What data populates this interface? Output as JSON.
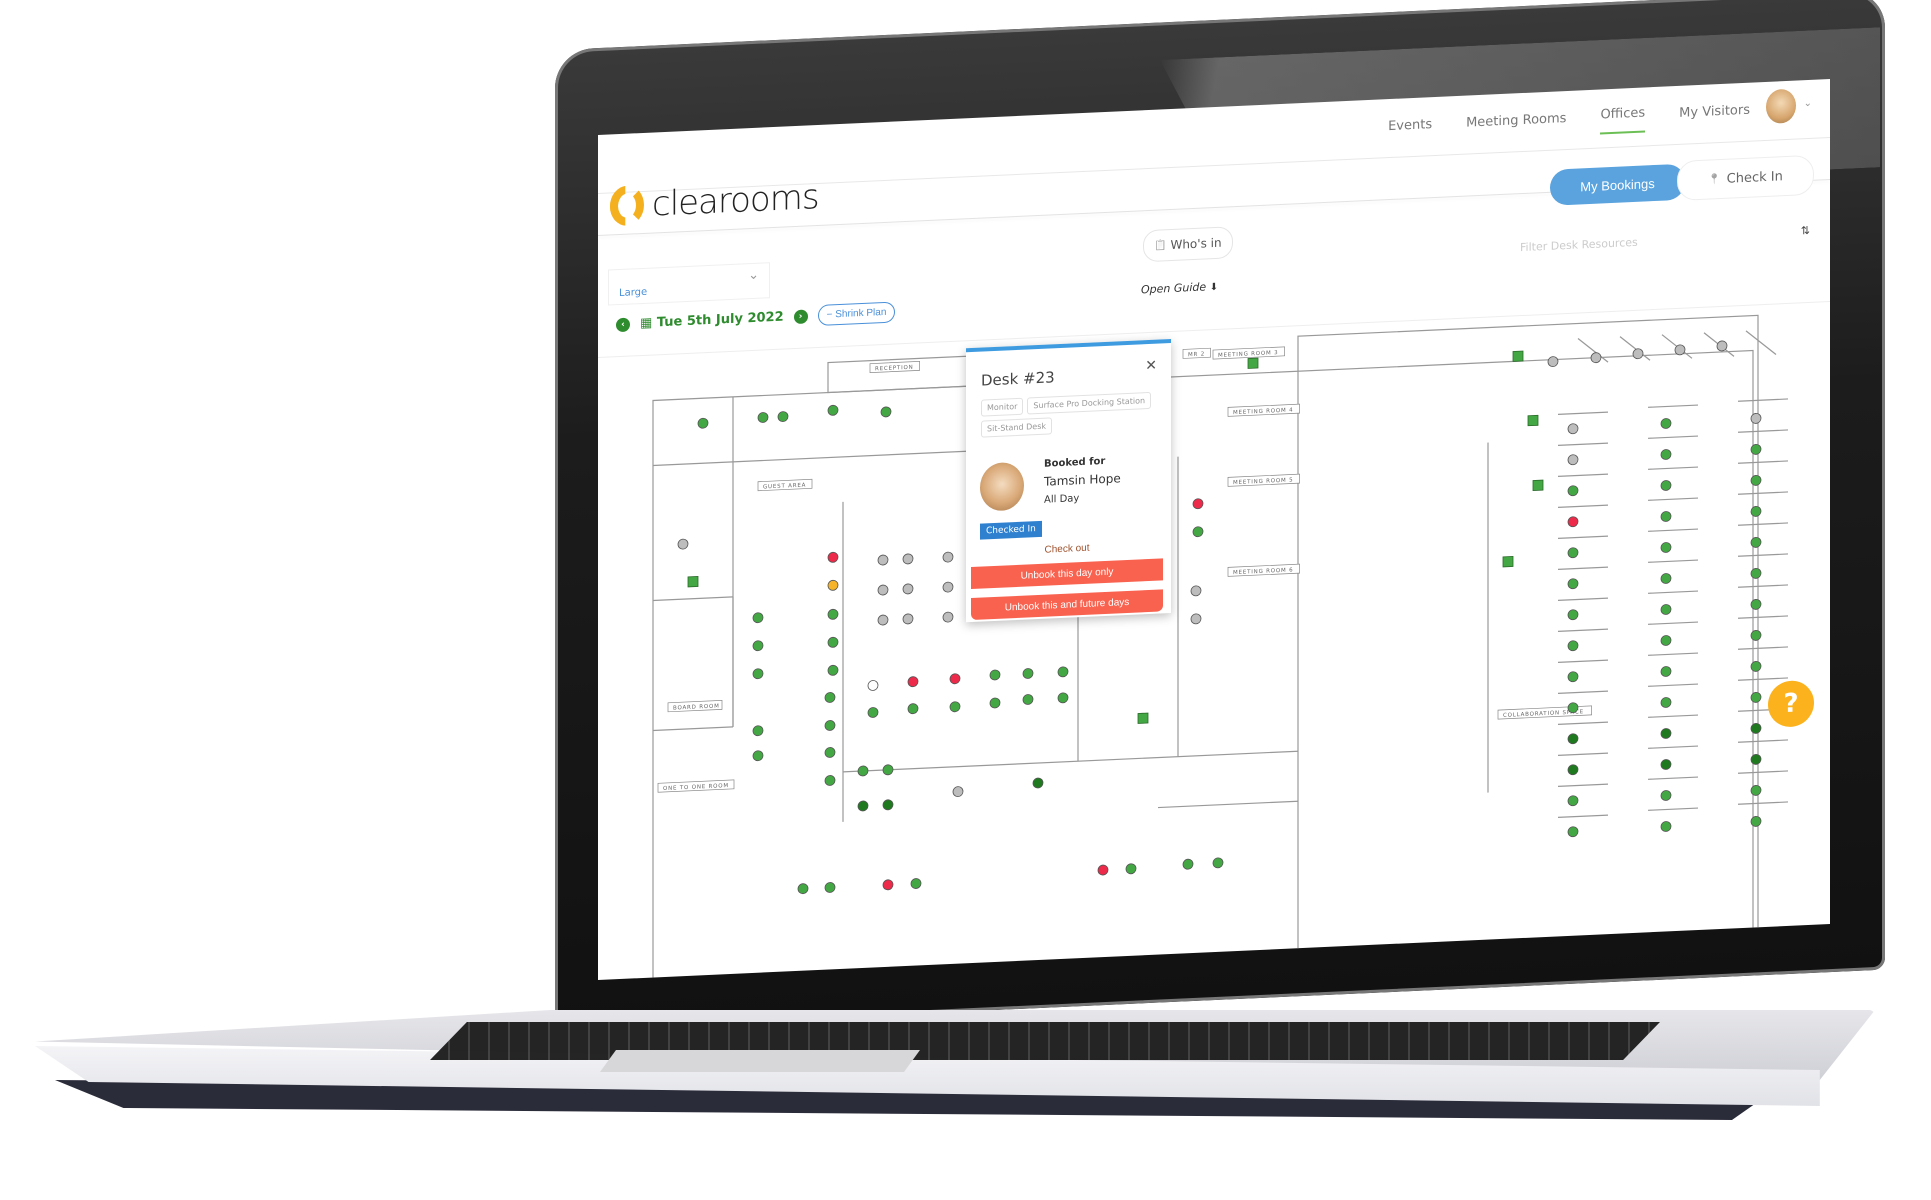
{
  "app": {
    "brand": "clearooms",
    "brand_color": "#f5b01f",
    "accent_green": "#2e8b2e",
    "accent_blue": "#5aa3de"
  },
  "nav": {
    "items": [
      {
        "label": "Events",
        "active": false
      },
      {
        "label": "Meeting Rooms",
        "active": false
      },
      {
        "label": "Offices",
        "active": true
      },
      {
        "label": "My Visitors",
        "active": false
      }
    ],
    "avatar_icon": "user-avatar",
    "caret": "⌄"
  },
  "toolbar": {
    "my_bookings_label": "My Bookings",
    "check_in_label": "Check In",
    "check_in_icon": "📍",
    "whos_in_label": "Who's in",
    "whos_in_icon": "📋",
    "size_select_value": "Large",
    "size_select_caret": "⌄",
    "open_guide_label": "Open Guide",
    "open_guide_icon": "⬇",
    "filter_placeholder": "Filter Desk Resources",
    "filter_sort_icon": "⇅",
    "prev_icon": "‹",
    "next_icon": "›",
    "calendar_icon": "▦",
    "date": "Tue 5th July 2022",
    "shrink_label": "− Shrink Plan"
  },
  "floorplan": {
    "room_labels": [
      "RECEPTION",
      "GUEST AREA",
      "BOARD ROOM",
      "ONE TO ONE ROOM",
      "MR 2",
      "MEETING ROOM 3",
      "MEETING ROOM 4",
      "MEETING ROOM 5",
      "MEETING ROOM 6",
      "COLLABORATION SPACE"
    ],
    "status_colors": {
      "available": "#43a843",
      "booked": "#ee2a4a",
      "pending": "#f6b42a",
      "unavailable": "#bdbdbd",
      "checked_in": "#1f7a1f"
    }
  },
  "popup": {
    "title": "Desk #23",
    "close_icon": "✕",
    "tags": [
      "Monitor",
      "Surface Pro Docking Station",
      "Sit-Stand Desk"
    ],
    "booked_for_label": "Booked for",
    "person_name": "Tamsin Hope",
    "duration": "All Day",
    "status_badge": "Checked In",
    "check_out_label": "Check out",
    "unbook_day_label": "Unbook this day only",
    "unbook_future_label": "Unbook this and future days"
  },
  "help": {
    "icon": "?"
  }
}
